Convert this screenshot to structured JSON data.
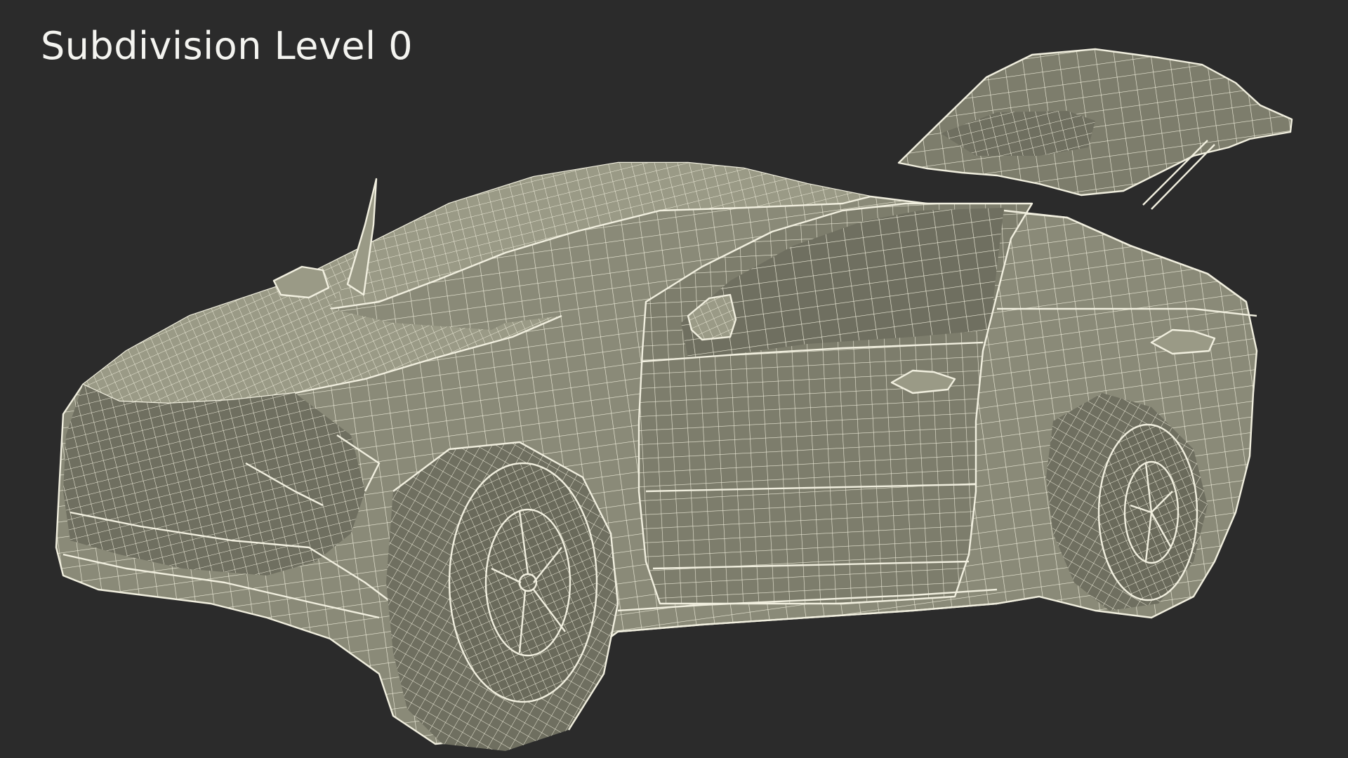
{
  "caption": {
    "text": "Subdivision Level 0"
  },
  "scene": {
    "subject": "car-wireframe-render",
    "background_color": "#2b2b2b",
    "surface_color": "#8a8a78",
    "wire_color": "#f1efdf"
  }
}
